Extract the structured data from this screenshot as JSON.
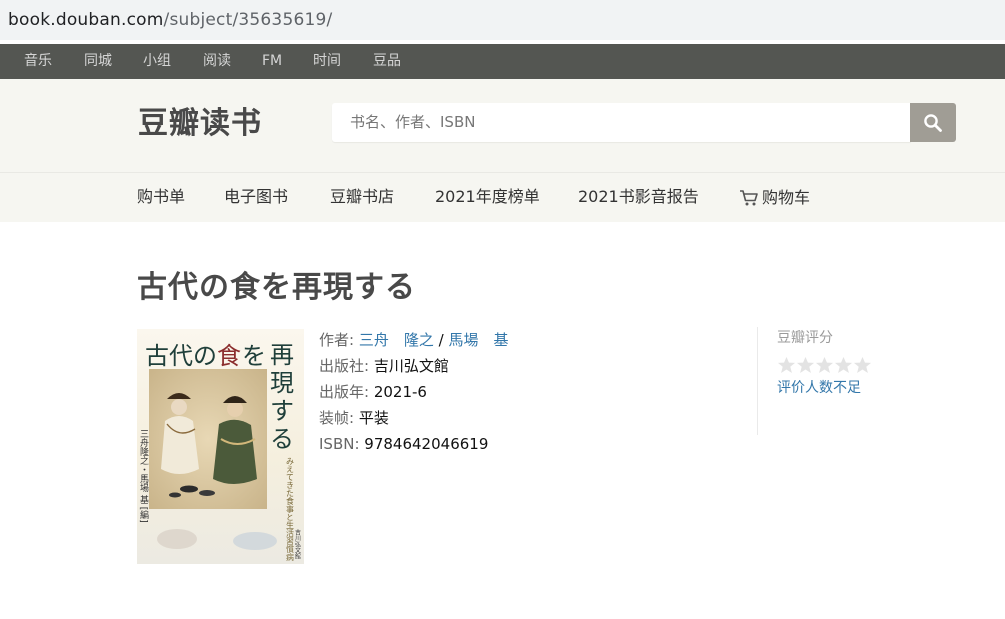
{
  "browser": {
    "url_host": "book.douban.com",
    "url_path": "/subject/35635619/"
  },
  "topnav": {
    "items": [
      "音乐",
      "同城",
      "小组",
      "阅读",
      "FM",
      "时间",
      "豆品"
    ]
  },
  "header": {
    "logo": "豆瓣读书",
    "search_placeholder": "书名、作者、ISBN"
  },
  "subnav": {
    "items": [
      "购书单",
      "电子图书",
      "豆瓣书店",
      "2021年度榜单",
      "2021书影音报告"
    ],
    "cart_label": "购物车"
  },
  "book": {
    "title": "古代の食を再現する",
    "cover": {
      "title_chars": [
        "古",
        "代",
        "の",
        "食",
        "を"
      ],
      "subtitle_chars": [
        "再",
        "現",
        "す",
        "る"
      ],
      "side_text": "みえてきた食事と生活習慣病",
      "editors": "三舟隆之・馬場 基 [編]",
      "publisher": "吉川弘文館"
    },
    "info": {
      "author_label": "作者:",
      "authors": [
        "三舟　隆之",
        "馬場　基"
      ],
      "author_sep": " / ",
      "publisher_label": "出版社:",
      "publisher": "吉川弘文館",
      "year_label": "出版年:",
      "year": "2021-6",
      "binding_label": "装帧:",
      "binding": "平装",
      "isbn_label": "ISBN:",
      "isbn": "9784642046619"
    },
    "rating": {
      "title": "豆瓣评分",
      "stars": 0,
      "status": "评价人数不足"
    }
  },
  "colors": {
    "topnav_bg": "#545652",
    "header_bg": "#f6f6f1",
    "link": "#37a",
    "search_button": "#a09d95"
  }
}
